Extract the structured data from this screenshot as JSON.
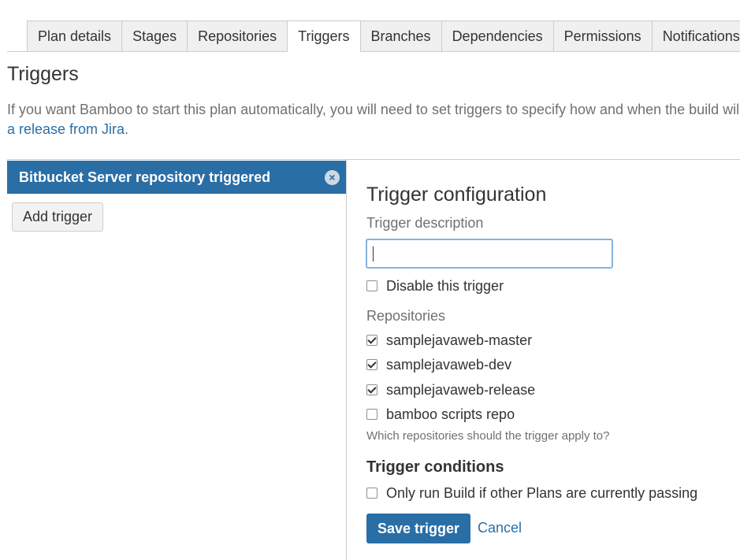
{
  "tabs": [
    {
      "label": "Plan details"
    },
    {
      "label": "Stages"
    },
    {
      "label": "Repositories"
    },
    {
      "label": "Triggers",
      "active": true
    },
    {
      "label": "Branches"
    },
    {
      "label": "Dependencies"
    },
    {
      "label": "Permissions"
    },
    {
      "label": "Notifications"
    }
  ],
  "page": {
    "title": "Triggers",
    "intro_text": "If you want Bamboo to start this plan automatically, you will need to set triggers to specify how and when the build will be",
    "intro_link": "a release from Jira",
    "intro_end": "."
  },
  "trigger_list": {
    "items": [
      {
        "label": "Bitbucket Server repository triggered",
        "remove_glyph": "×"
      }
    ],
    "add_button": "Add trigger"
  },
  "config": {
    "title": "Trigger configuration",
    "description_label": "Trigger description",
    "description_value": "",
    "disable_label": "Disable this trigger",
    "disable_checked": false,
    "repositories_label": "Repositories",
    "repositories": [
      {
        "name": "samplejavaweb-master",
        "checked": true
      },
      {
        "name": "samplejavaweb-dev",
        "checked": true
      },
      {
        "name": "samplejavaweb-release",
        "checked": true
      },
      {
        "name": "bamboo scripts repo",
        "checked": false
      }
    ],
    "repositories_help": "Which repositories should the trigger apply to?",
    "conditions_title": "Trigger conditions",
    "condition_label": "Only run Build if other Plans are currently passing",
    "condition_checked": false,
    "save_label": "Save trigger",
    "cancel_label": "Cancel"
  },
  "colors": {
    "accent": "#2a6ea6",
    "link": "#2a6fa8",
    "muted_text": "#707070"
  },
  "icons": {
    "remove": "close-icon"
  }
}
